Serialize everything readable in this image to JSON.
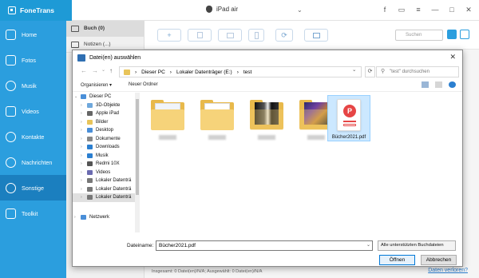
{
  "app": {
    "name": "FoneTrans",
    "device": "iPad air",
    "accent": "#2b9ede",
    "title_icons": [
      "facebook-icon",
      "feedback-icon",
      "menu-icon",
      "minimize-icon",
      "maximize-icon",
      "close-icon"
    ]
  },
  "title_glyphs": {
    "facebook": "f",
    "feedback": "▭",
    "menu": "≡",
    "minimize": "—",
    "maximize": "□",
    "close": "✕",
    "dropdown": "⌄"
  },
  "sidebar": {
    "items": [
      {
        "label": "Home",
        "icon": "home-icon",
        "active": false
      },
      {
        "label": "Fotos",
        "icon": "photos-icon",
        "active": false
      },
      {
        "label": "Musik",
        "icon": "music-icon",
        "active": false
      },
      {
        "label": "Videos",
        "icon": "videos-icon",
        "active": false
      },
      {
        "label": "Kontakte",
        "icon": "contacts-icon",
        "active": false
      },
      {
        "label": "Nachrichten",
        "icon": "messages-icon",
        "active": false
      },
      {
        "label": "Sonstige",
        "icon": "other-icon",
        "active": true
      },
      {
        "label": "Toolkit",
        "icon": "toolkit-icon",
        "active": false
      }
    ]
  },
  "categories": [
    {
      "label": "Buch (0)",
      "selected": true
    },
    {
      "label": "Notizen (...)",
      "selected": false
    }
  ],
  "toolbar": {
    "search_placeholder": "Suchen",
    "add": "+",
    "refresh": "⟳"
  },
  "status": {
    "text": "Insgesamt: 0 Datei(en)/N/A; Ausgewählt: 0 Datei(en)/N/A",
    "lost_link": "Daten verloren?"
  },
  "dialog": {
    "title": "Datei(en) auswählen",
    "close": "✕",
    "nav": {
      "back": "←",
      "forward": "→",
      "dropdown": "⌄",
      "up": "↑",
      "refresh": "⟳"
    },
    "breadcrumb": [
      "Dieser PC",
      "Lokaler Datenträger (E:)",
      "test"
    ],
    "breadcrumb_sep": "›",
    "search_placeholder": "\"test\" durchsuchen",
    "organize": "Organisieren",
    "organize_caret": "▾",
    "new_folder": "Neuer Ordner",
    "tree": [
      {
        "label": "Dieser PC",
        "color": "#4a8fd8",
        "level": 0,
        "expand": "⌄",
        "selected": false
      },
      {
        "label": "3D-Objekte",
        "color": "#6fa8dc",
        "level": 1,
        "expand": "›",
        "selected": false
      },
      {
        "label": "Apple iPad",
        "color": "#666666",
        "level": 1,
        "expand": "›",
        "selected": false
      },
      {
        "label": "Bilder",
        "color": "#e8c45a",
        "level": 1,
        "expand": "›",
        "selected": false
      },
      {
        "label": "Desktop",
        "color": "#4a8fd8",
        "level": 1,
        "expand": "›",
        "selected": false
      },
      {
        "label": "Dokumente",
        "color": "#888888",
        "level": 1,
        "expand": "›",
        "selected": false
      },
      {
        "label": "Downloads",
        "color": "#2b7fd0",
        "level": 1,
        "expand": "›",
        "selected": false
      },
      {
        "label": "Musik",
        "color": "#2b7fd0",
        "level": 1,
        "expand": "›",
        "selected": false
      },
      {
        "label": "Redmi 10X",
        "color": "#555555",
        "level": 1,
        "expand": "›",
        "selected": false
      },
      {
        "label": "Videos",
        "color": "#6b6bb0",
        "level": 1,
        "expand": "›",
        "selected": false
      },
      {
        "label": "Lokaler Datenträ",
        "color": "#777777",
        "level": 1,
        "expand": "›",
        "selected": false
      },
      {
        "label": "Lokaler Datenträ",
        "color": "#777777",
        "level": 1,
        "expand": "›",
        "selected": false
      },
      {
        "label": "Lokaler Datenträ",
        "color": "#777777",
        "level": 1,
        "expand": "›",
        "selected": true
      },
      {
        "label": "",
        "color": "#ffffff",
        "level": 1,
        "expand": "",
        "selected": false
      },
      {
        "label": "Netzwerk",
        "color": "#4a8fd8",
        "level": 0,
        "expand": "›",
        "selected": false
      }
    ],
    "files": [
      {
        "kind": "folder-docs",
        "label": ""
      },
      {
        "kind": "folder-plain",
        "label": ""
      },
      {
        "kind": "folder-dark",
        "label": ""
      },
      {
        "kind": "folder-photos",
        "label": ""
      },
      {
        "kind": "pdf",
        "label": "Bücher2021.pdf",
        "pdf_glyph": "P",
        "selected": true
      }
    ],
    "filename_label": "Dateiname:",
    "filename_value": "Bücher2021.pdf",
    "filename_caret": "⌄",
    "filter": "Alle unterstützten Buchdateien",
    "open_button": "Öffnen",
    "cancel_button": "Abbrechen"
  }
}
